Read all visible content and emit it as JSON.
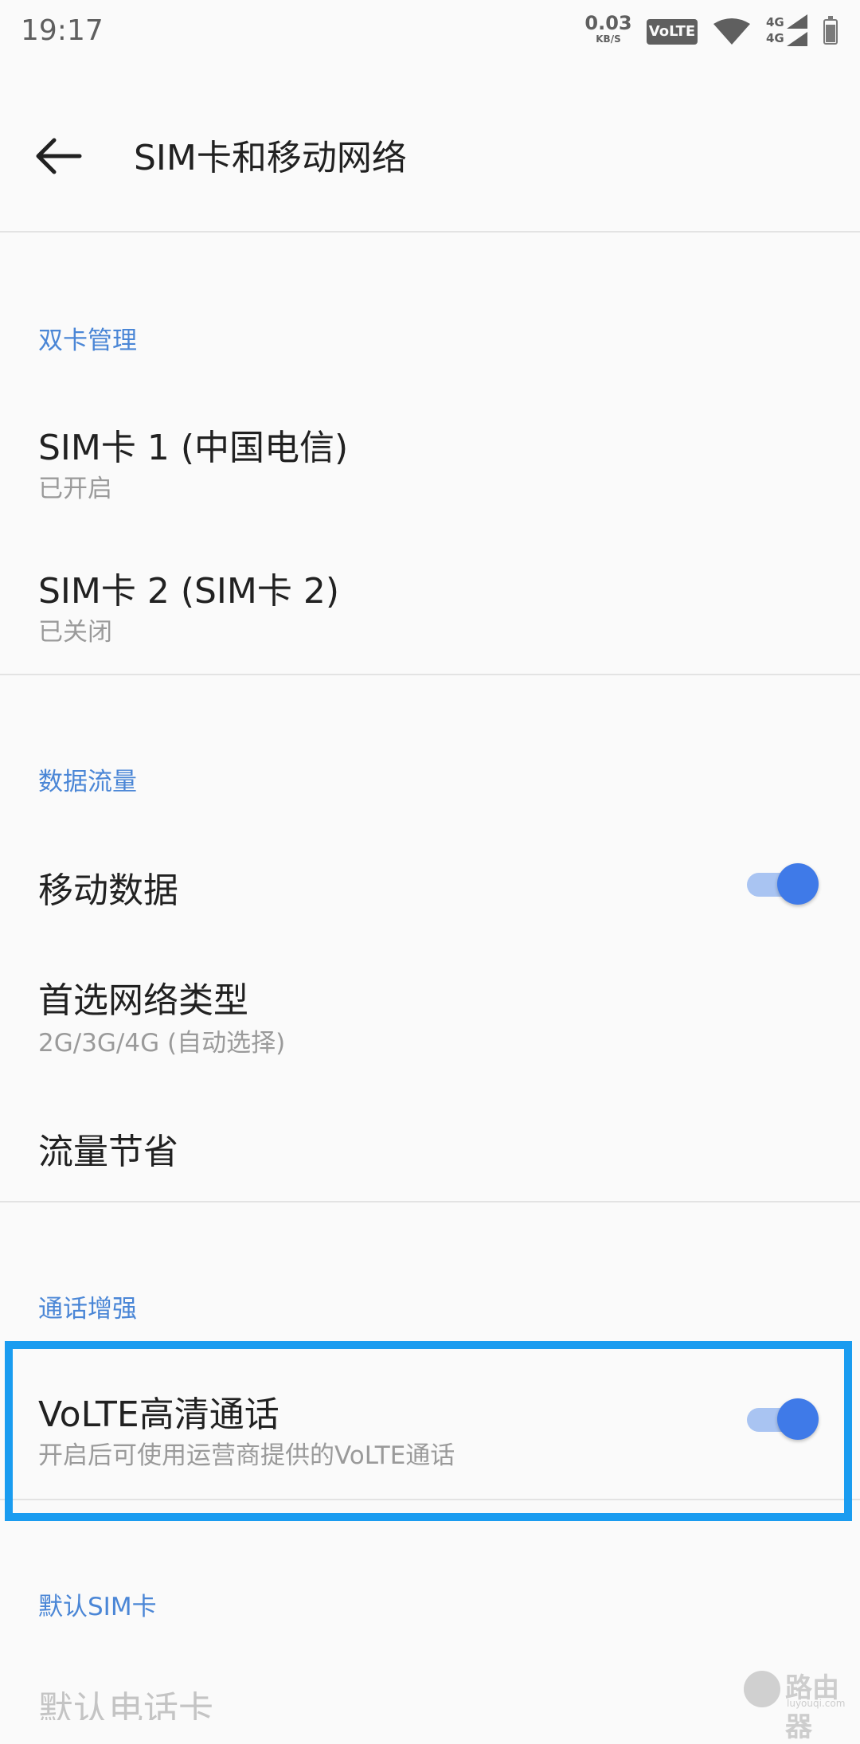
{
  "status_bar": {
    "time": "19:17",
    "speed_value": "0.03",
    "speed_unit": "KB/S",
    "volte_badge": "VoLTE",
    "signal1_label": "4G",
    "signal2_label": "4G"
  },
  "toolbar": {
    "title": "SIM卡和移动网络"
  },
  "sections": {
    "dual_sim": {
      "header": "双卡管理",
      "sim1_title": "SIM卡 1  (中国电信)",
      "sim1_status": "已开启",
      "sim2_title": "SIM卡 2  (SIM卡 2)",
      "sim2_status": "已关闭"
    },
    "data": {
      "header": "数据流量",
      "mobile_data_label": "移动数据",
      "mobile_data_on": true,
      "preferred_network_label": "首选网络类型",
      "preferred_network_value": "2G/3G/4G (自动选择)",
      "data_saver_label": "流量节省"
    },
    "call": {
      "header": "通话增强",
      "volte_label": "VoLTE高清通话",
      "volte_desc": "开启后可使用运营商提供的VoLTE通话",
      "volte_on": true
    },
    "default_sim": {
      "header": "默认SIM卡",
      "default_phone_label": "默认电话卡"
    }
  },
  "watermark": {
    "text": "路由器",
    "url": "luyouqi.com"
  },
  "colors": {
    "accent": "#3f7ae8",
    "section_header": "#4a86d6",
    "highlight_border": "#1a9cf0"
  }
}
